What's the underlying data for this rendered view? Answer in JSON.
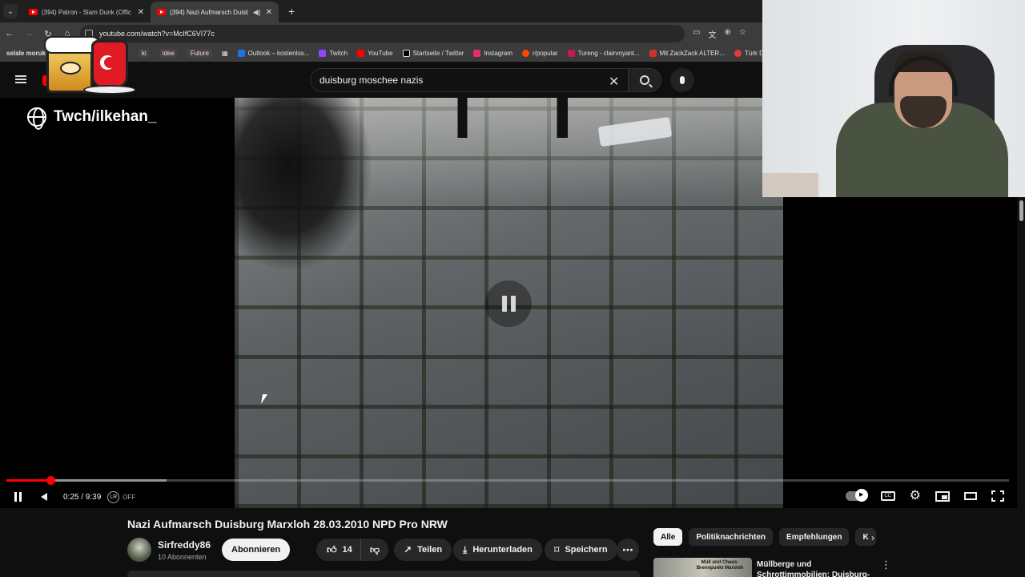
{
  "browser": {
    "tabs": [
      {
        "title": "(394) Patron - Slam Dunk (Offic",
        "active": false
      },
      {
        "title": "(394) Nazi Aufmarsch Duisb",
        "active": true
      }
    ],
    "address": "youtube.com/watch?v=McIfC6VI77c",
    "bookmarks": [
      {
        "label": "selale moruk"
      },
      {
        "label": "ki"
      },
      {
        "label": "idee"
      },
      {
        "label": "Future"
      },
      {
        "label": "Outlook – kostenlos..."
      },
      {
        "label": "Twitch"
      },
      {
        "label": "YouTube"
      },
      {
        "label": "Startseite / Twitter"
      },
      {
        "label": "Instagram"
      },
      {
        "label": "r/popular"
      },
      {
        "label": "Tureng - clairvoyant..."
      },
      {
        "label": "Mit ZackZack ALTER..."
      },
      {
        "label": "Türk Dil"
      }
    ]
  },
  "youtube": {
    "search_query": "duisburg moschee nazis",
    "overlay_channel": "Twch/ilkehan_",
    "player": {
      "time": "0:25 / 9:39",
      "lr_badge": "LR",
      "lr_state": "OFF",
      "progress_played": 0.044,
      "progress_buffered": 0.16,
      "cc_label": "CC",
      "state": "playing"
    },
    "video": {
      "title": "Nazi Aufmarsch Duisburg Marxloh 28.03.2010 NPD Pro NRW",
      "channel": "Sirfreddy86",
      "subscribers": "10 Abonnenten",
      "subscribe_label": "Abonnieren",
      "likes": "14",
      "share_label": "Teilen",
      "download_label": "Herunterladen",
      "save_label": "Speichern"
    },
    "chips": [
      "Alle",
      "Politiknachrichten",
      "Empfehlungen",
      "K"
    ],
    "recommendation": {
      "thumb_text": "Müll und Chaos: Brennpunkt Marxloh",
      "title": "Müllberge und Schrottimmobilien: Duisburg-"
    }
  },
  "colors": {
    "accent": "#ff0000",
    "background": "#0f0f0f",
    "chip_active": "#f1f1f1"
  }
}
